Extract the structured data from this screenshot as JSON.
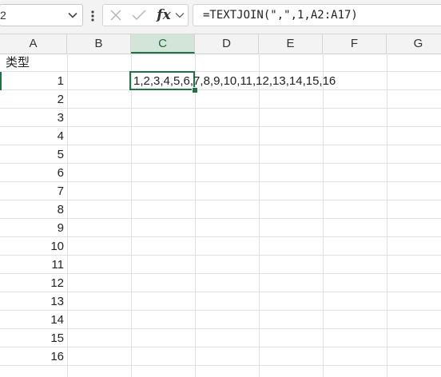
{
  "name_box": {
    "value": "2"
  },
  "formula_bar": {
    "formula": "=TEXTJOIN(\",\",1,A2:A17)"
  },
  "columns": [
    {
      "label": "A",
      "active": false
    },
    {
      "label": "B",
      "active": false
    },
    {
      "label": "C",
      "active": true
    },
    {
      "label": "D",
      "active": false
    },
    {
      "label": "E",
      "active": false
    },
    {
      "label": "F",
      "active": false
    },
    {
      "label": "G",
      "active": false
    }
  ],
  "column_a_cells": [
    "类型",
    "1",
    "2",
    "3",
    "4",
    "5",
    "6",
    "7",
    "8",
    "9",
    "10",
    "11",
    "12",
    "13",
    "14",
    "15",
    "16"
  ],
  "active_cell": {
    "value": "1,2,3,4,5,6,7,8,9,10,11,12,13,14,15,16"
  },
  "colors": {
    "accent": "#217346",
    "active_header_bg": "#d3e4d8",
    "gridline": "#e1e1e1"
  },
  "icons": [
    "chevron-down-icon",
    "more-vertical-icon",
    "cancel-icon",
    "enter-check-icon",
    "fx-icon"
  ]
}
